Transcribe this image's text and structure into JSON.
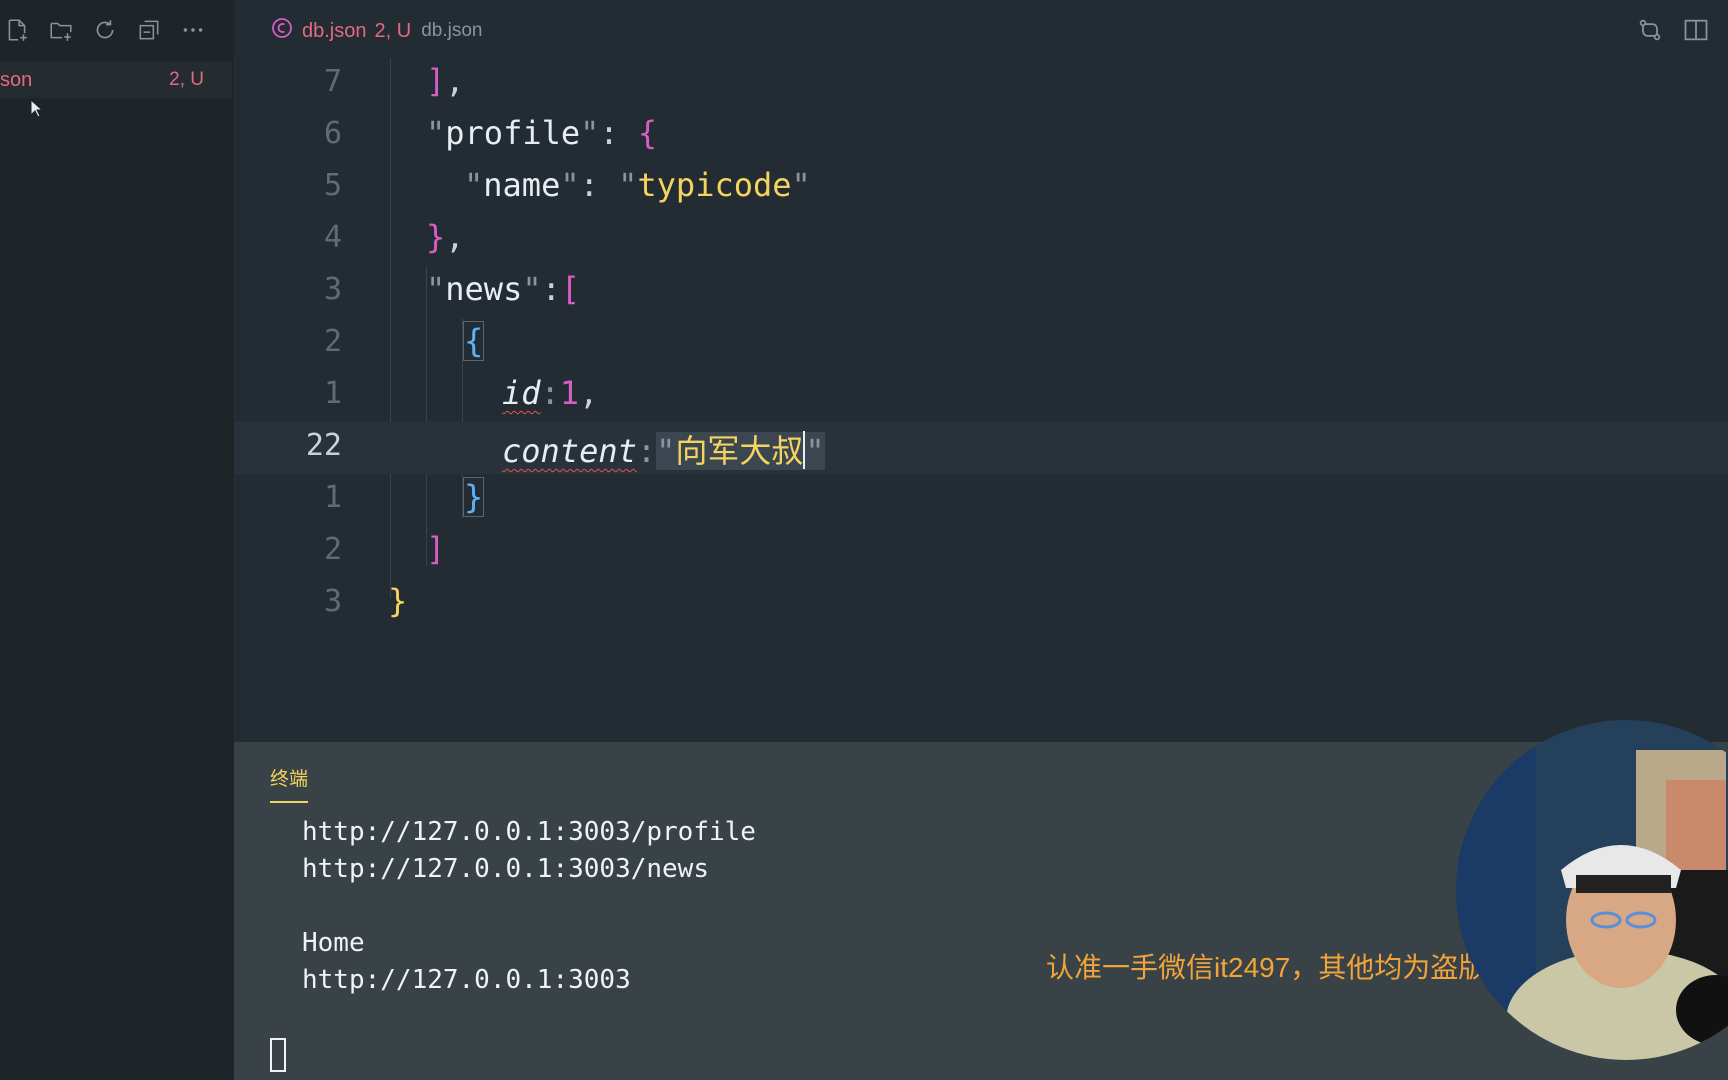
{
  "sidebar": {
    "toolbar": [
      "new-file-icon",
      "new-folder-icon",
      "refresh-icon",
      "collapse-all-icon",
      "more-actions-icon"
    ],
    "file": {
      "name": "son",
      "status": "2, U"
    }
  },
  "tab": {
    "title": "db.json",
    "status": "2, U",
    "path": "db.json"
  },
  "editor": {
    "lines": [
      {
        "num": "7"
      },
      {
        "num": "6"
      },
      {
        "num": "5"
      },
      {
        "num": "4"
      },
      {
        "num": "3"
      },
      {
        "num": "2"
      },
      {
        "num": "1"
      },
      {
        "num": "22"
      },
      {
        "num": "1"
      },
      {
        "num": "2"
      },
      {
        "num": "3"
      }
    ],
    "tokens": {
      "close_arr": "]",
      "comma": ",",
      "profile_key": "profile",
      "name_key": "name",
      "name_val": "typicode",
      "news_key": "news",
      "id_key": "id",
      "id_val": "1",
      "content_key": "content",
      "content_val": "向军大叔"
    }
  },
  "panel": {
    "tab_label": "终端",
    "output": "http://127.0.0.1:3003/profile\nhttp://127.0.0.1:3003/news\n\nHome\nhttp://127.0.0.1:3003"
  },
  "watermark": "认准一手微信it2497，其他均为盗版",
  "colors": {
    "accent": "#f4d35e",
    "git_untracked": "#e26b7f",
    "editor_bg": "#232b33",
    "panel_bg": "#394246"
  }
}
